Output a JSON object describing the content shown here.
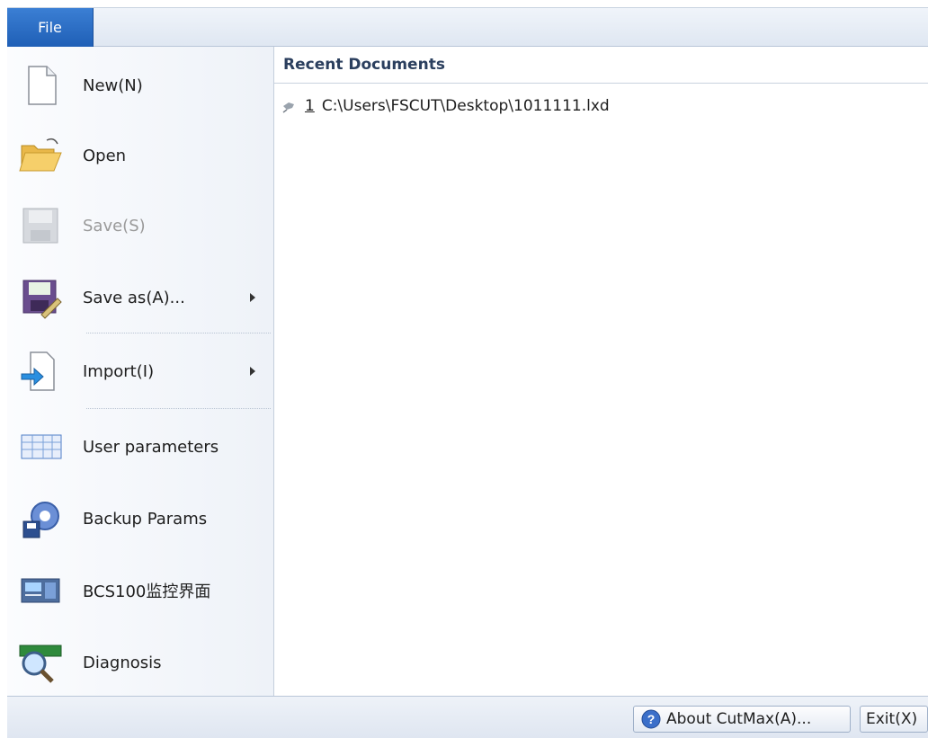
{
  "tab": {
    "file_label": "File"
  },
  "menu": {
    "items": [
      {
        "label": "New(N)",
        "icon": "new-document-icon"
      },
      {
        "label": "Open",
        "icon": "folder-open-icon"
      },
      {
        "label": "Save(S)",
        "icon": "save-disk-icon"
      },
      {
        "label": "Save as(A)...",
        "icon": "save-as-icon"
      },
      {
        "label": "Import(I)",
        "icon": "import-icon"
      },
      {
        "label": "User parameters",
        "icon": "table-icon"
      },
      {
        "label": "Backup Params",
        "icon": "gear-disk-icon"
      },
      {
        "label": "BCS100监控界面",
        "icon": "monitor-panel-icon"
      },
      {
        "label": "Diagnosis",
        "icon": "magnifier-board-icon"
      }
    ]
  },
  "recent": {
    "header": "Recent Documents",
    "items": [
      {
        "number": "1",
        "path": "C:\\Users\\FSCUT\\Desktop\\1011111.lxd"
      }
    ]
  },
  "footer": {
    "about_label": "About CutMax(A)...",
    "exit_label": "Exit(X)"
  },
  "colors": {
    "file_tab": "#2a6bc4",
    "disabled_text": "#9a9a9a",
    "header_text": "#2b3f5e"
  }
}
